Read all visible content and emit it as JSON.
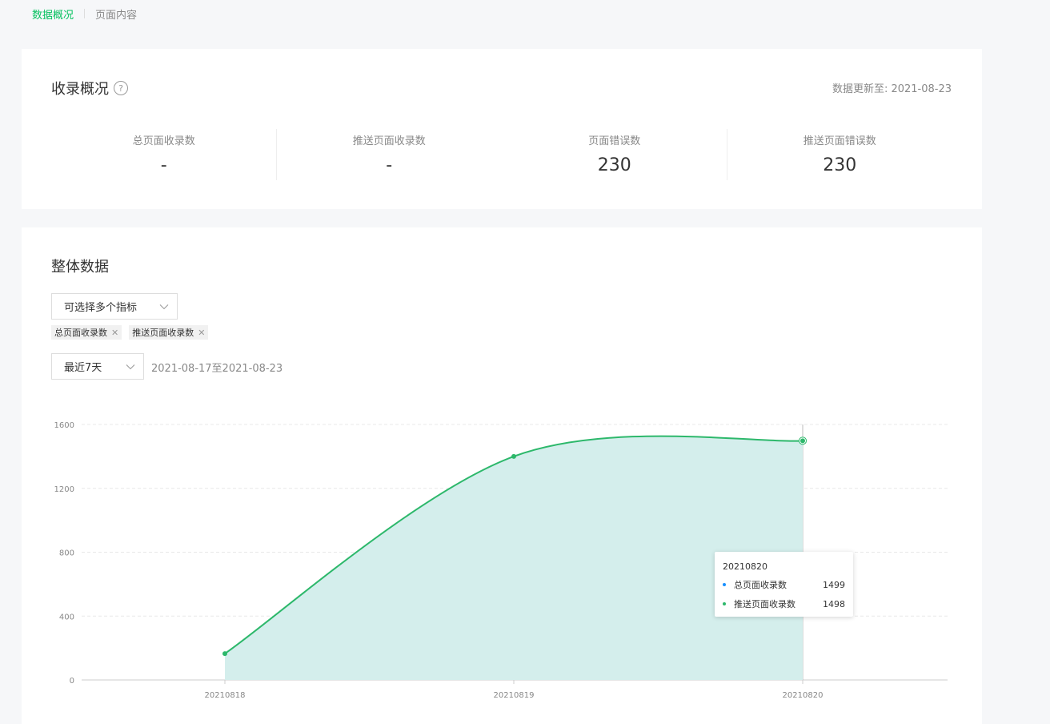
{
  "nav": {
    "tabs": [
      "数据概况",
      "页面内容"
    ]
  },
  "overview": {
    "title": "收录概况",
    "help_glyph": "?",
    "update_label": "数据更新至:",
    "update_date": "2021-08-23",
    "stats": [
      {
        "label": "总页面收录数",
        "value": "-"
      },
      {
        "label": "推送页面收录数",
        "value": "-"
      },
      {
        "label": "页面错误数",
        "value": "230"
      },
      {
        "label": "推送页面错误数",
        "value": "230"
      }
    ]
  },
  "overall": {
    "title": "整体数据",
    "metric_placeholder": "可选择多个指标",
    "selected_metrics": [
      "总页面收录数",
      "推送页面收录数"
    ],
    "range_select": "最近7天",
    "date_range": "2021-08-17至2021-08-23"
  },
  "colors": {
    "accent": "#07c160",
    "series_blue": "#1890ff",
    "series_green": "#2db86b",
    "area": "#d4eeec"
  },
  "tooltip": {
    "title": "20210820",
    "rows": [
      {
        "name": "总页面收录数",
        "value": "1499",
        "color": "#1890ff"
      },
      {
        "name": "推送页面收录数",
        "value": "1498",
        "color": "#2db86b"
      }
    ]
  },
  "chart_data": {
    "type": "area",
    "categories": [
      "20210818",
      "20210819",
      "20210820"
    ],
    "series": [
      {
        "name": "总页面收录数",
        "values": [
          165,
          1400,
          1499
        ]
      },
      {
        "name": "推送页面收录数",
        "values": [
          165,
          1400,
          1498
        ]
      }
    ],
    "ylim": [
      0,
      1600
    ],
    "yticks": [
      0,
      400,
      800,
      1200,
      1600
    ],
    "grid": true,
    "highlight_category": "20210820"
  }
}
